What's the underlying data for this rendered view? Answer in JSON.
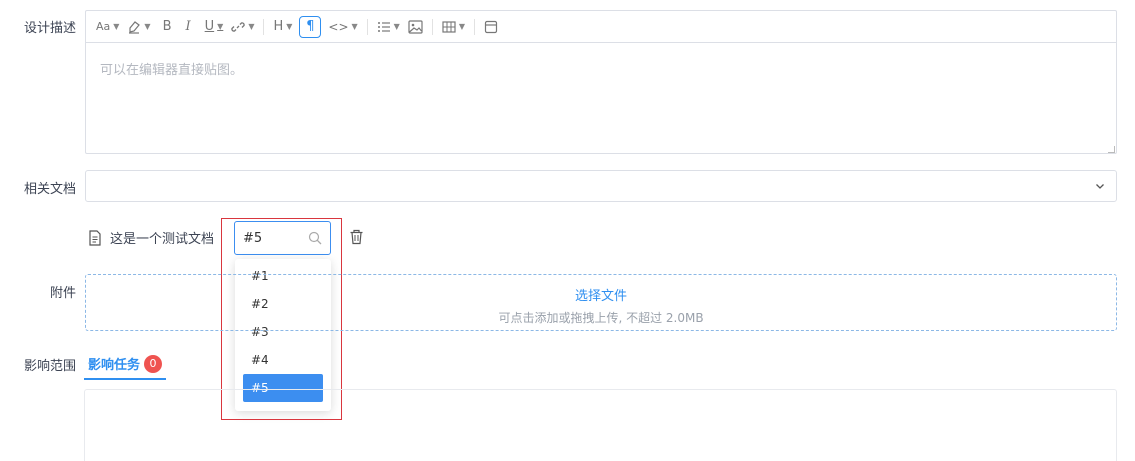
{
  "form": {
    "design_label": "设计描述",
    "docs_label": "相关文档",
    "attach_label": "附件",
    "scope_label": "影响范围"
  },
  "editor": {
    "placeholder": "可以在编辑器直接贴图。",
    "toolbar": {
      "font_icon_text": "Aa",
      "bold": "B",
      "italic": "I",
      "underline": "U",
      "heading": "H",
      "paragraph": "¶",
      "code": "<>"
    }
  },
  "doc": {
    "name": "这是一个测试文档",
    "search_value": "#5",
    "options": [
      "#1",
      "#2",
      "#3",
      "#4",
      "#5"
    ],
    "selected": "#5"
  },
  "upload": {
    "title": "选择文件",
    "hint": "可点击添加或拖拽上传, 不超过 2.0MB"
  },
  "tabs": {
    "active_label": "影响任务",
    "badge_count": "0"
  },
  "colors": {
    "accent": "#2f8ff0",
    "highlight": "#d9363e",
    "badge": "#ef5350"
  }
}
